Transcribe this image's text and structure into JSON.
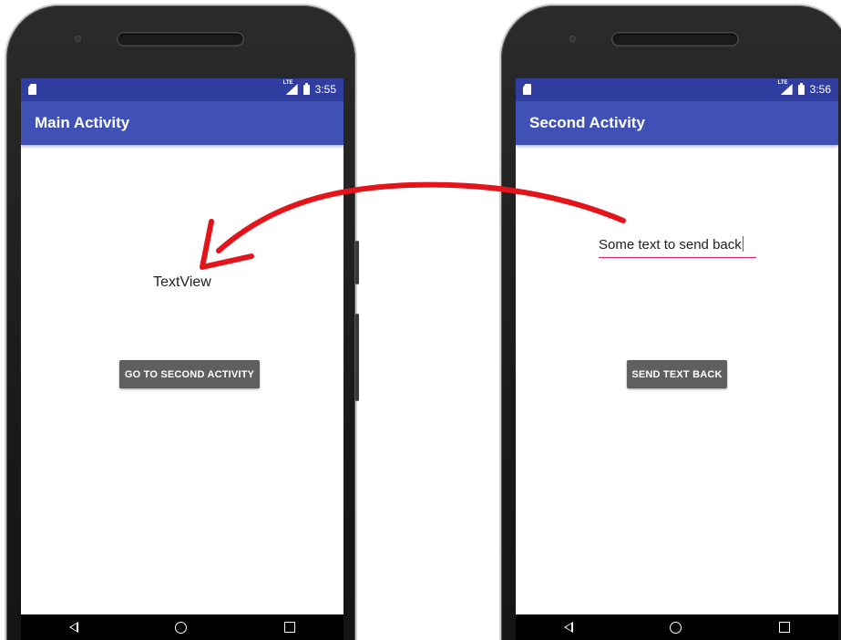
{
  "colors": {
    "statusbar": "#303F9F",
    "appbar": "#3F51B5",
    "accent": "#E91E63",
    "button": "#5f5f5f",
    "arrow": "#e3151a"
  },
  "left_phone": {
    "status": {
      "time": "3:55",
      "network": "LTE"
    },
    "title": "Main Activity",
    "text_view": "TextView",
    "button_label": "GO TO SECOND ACTIVITY",
    "nav_icons": [
      "back-icon",
      "home-icon",
      "recents-icon"
    ]
  },
  "right_phone": {
    "status": {
      "time": "3:56",
      "network": "LTE"
    },
    "title": "Second Activity",
    "input_value": "Some text to send back",
    "button_label": "SEND TEXT BACK",
    "nav_icons": [
      "back-icon",
      "home-icon",
      "recents-icon"
    ]
  }
}
